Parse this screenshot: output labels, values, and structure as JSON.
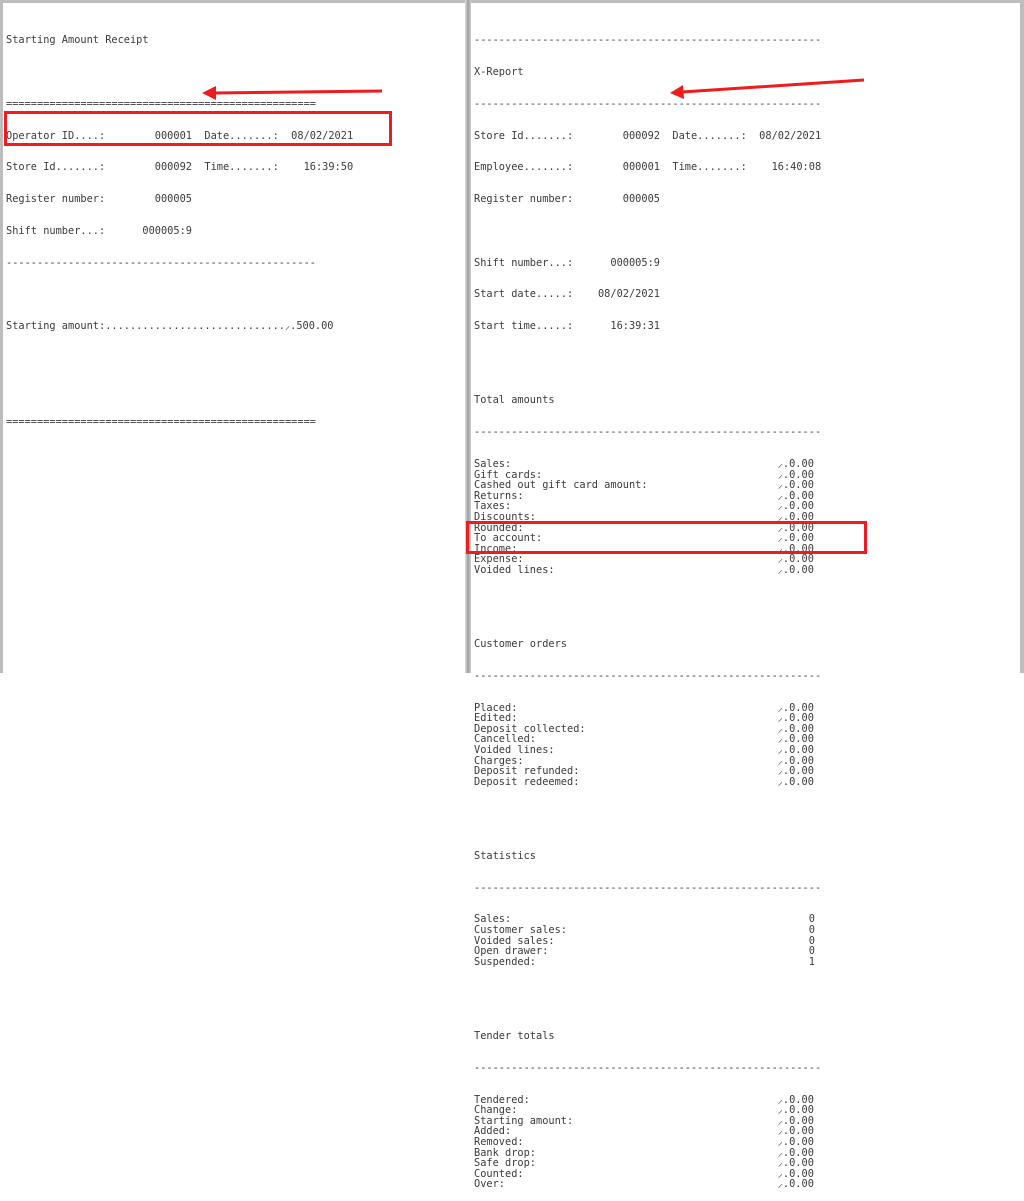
{
  "left_receipt": {
    "title": "Starting Amount Receipt",
    "rule_double": "==================================================",
    "rule_single": "--------------------------------------------------",
    "operator_line": "Operator ID....:        000001  Date.......:  08/02/2021",
    "store_line": "Store Id.......:        000092  Time.......:    16:39:50",
    "register_line": "Register number:        000005",
    "shift_line": "Shift number...:      000005:9",
    "starting_amount_line": "Starting amount:.............................⸝.500.00"
  },
  "right_report": {
    "rule_single": "--------------------------------------------------------",
    "title": "X-Report",
    "store_line": "Store Id.......:        000092  Date.......:  08/02/2021",
    "employee_line": "Employee.......:        000001  Time.......:    16:40:08",
    "register_line": "Register number:        000005",
    "shift_line": "Shift number...:      000005:9",
    "start_date_line": "Start date.....:    08/02/2021",
    "start_time_line": "Start time.....:      16:39:31",
    "total_amounts": {
      "heading": "Total amounts",
      "rows": [
        "Sales:                                           ⸝.0.00",
        "Gift cards:                                      ⸝.0.00",
        "Cashed out gift card amount:                     ⸝.0.00",
        "Returns:                                         ⸝.0.00",
        "Taxes:                                           ⸝.0.00",
        "Discounts:                                       ⸝.0.00",
        "Rounded:                                         ⸝.0.00",
        "To account:                                      ⸝.0.00",
        "Income:                                          ⸝.0.00",
        "Expense:                                         ⸝.0.00",
        "Voided lines:                                    ⸝.0.00"
      ]
    },
    "customer_orders": {
      "heading": "Customer orders",
      "rows": [
        "Placed:                                          ⸝.0.00",
        "Edited:                                          ⸝.0.00",
        "Deposit collected:                               ⸝.0.00",
        "Cancelled:                                       ⸝.0.00",
        "Voided lines:                                    ⸝.0.00",
        "Charges:                                         ⸝.0.00",
        "Deposit refunded:                                ⸝.0.00",
        "Deposit redeemed:                                ⸝.0.00"
      ]
    },
    "statistics": {
      "heading": "Statistics",
      "rows": [
        "Sales:                                                0",
        "Customer sales:                                       0",
        "Voided sales:                                         0",
        "Open drawer:                                          0",
        "Suspended:                                            1"
      ]
    },
    "tender_totals": {
      "heading": "Tender totals",
      "rows": [
        "Tendered:                                        ⸝.0.00",
        "Change:                                          ⸝.0.00",
        "Starting amount:                                 ⸝.0.00",
        "Added:                                           ⸝.0.00",
        "Removed:                                         ⸝.0.00",
        "Bank drop:                                       ⸝.0.00",
        "Safe drop:                                       ⸝.0.00",
        "Counted:                                         ⸝.0.00",
        "Over:                                            ⸝.0.00"
      ]
    }
  },
  "annotations": {
    "color": "#ee1c1c"
  }
}
